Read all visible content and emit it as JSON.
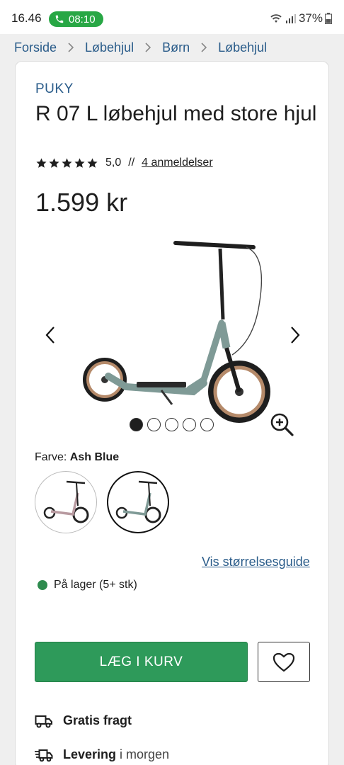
{
  "status_bar": {
    "time": "16.46",
    "call_time": "08:10",
    "battery": "37%"
  },
  "breadcrumb": [
    "Forside",
    "Løbehjul",
    "Børn",
    "Løbehjul"
  ],
  "product": {
    "brand": "PUKY",
    "title": "R 07 L løbehjul med store hjul",
    "rating_value": "5,0",
    "rating_stars": 5,
    "rating_separator": "//",
    "reviews_link": "4 anmeldelser",
    "price": "1.599 kr"
  },
  "gallery": {
    "image_count": 5,
    "active_index": 0
  },
  "color": {
    "label": "Farve:",
    "selected": "Ash Blue",
    "swatches": [
      "rose",
      "ash-blue"
    ]
  },
  "size_guide_link": "Vis størrelsesguide",
  "stock": {
    "text": "På lager (5+ stk)",
    "color": "#2e8b4e"
  },
  "actions": {
    "add_to_cart": "LÆG I KURV",
    "accent": "#2e9a5a"
  },
  "usps": [
    {
      "icon": "truck-icon",
      "bold": "Gratis fragt",
      "rest": ""
    },
    {
      "icon": "fast-delivery-icon",
      "bold": "Levering",
      "rest": "i morgen"
    }
  ]
}
